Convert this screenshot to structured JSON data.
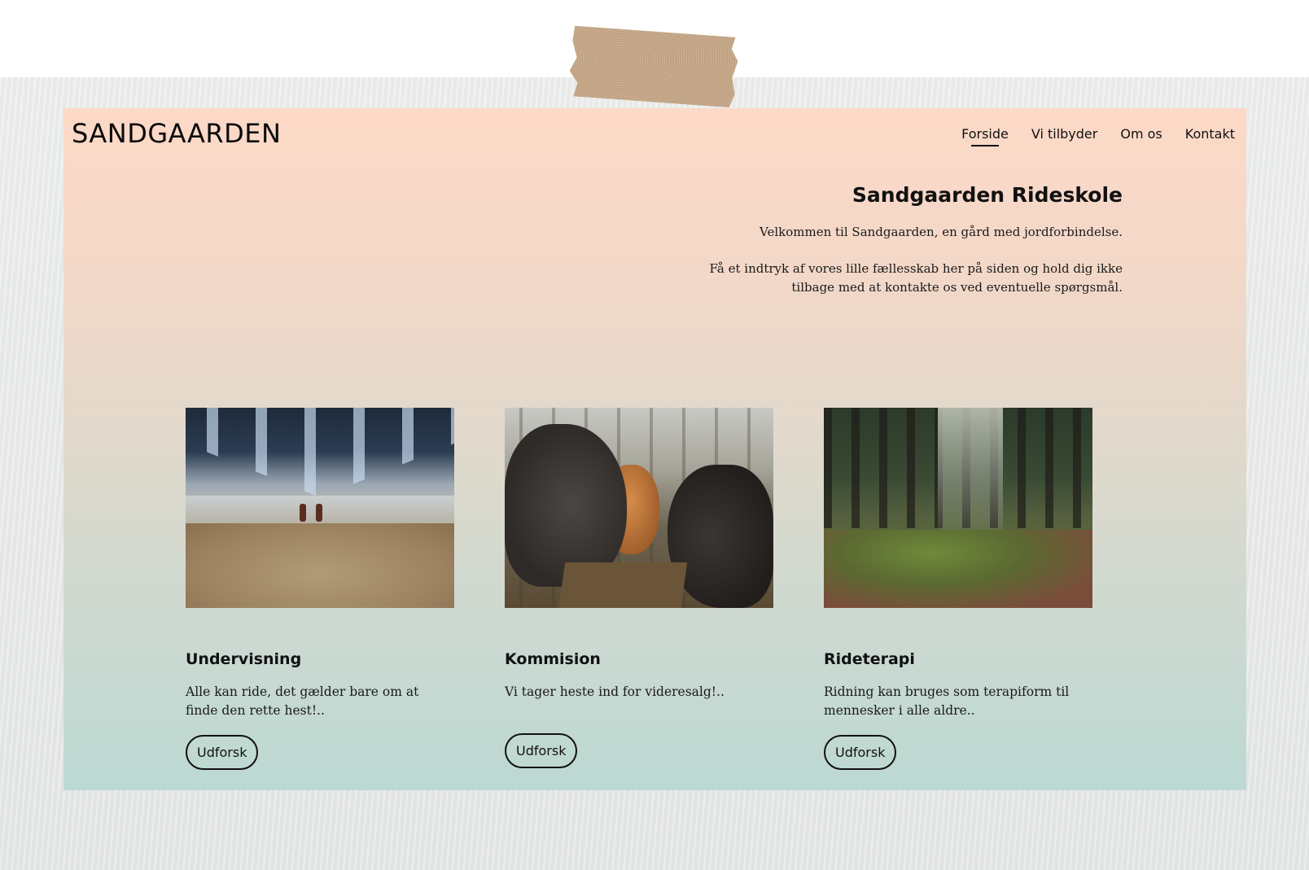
{
  "site": {
    "logo": "SANDGAARDEN",
    "nav": [
      {
        "label": "Forside",
        "active": true
      },
      {
        "label": "Vi tilbyder",
        "active": false
      },
      {
        "label": "Om os",
        "active": false
      },
      {
        "label": "Kontakt",
        "active": false
      }
    ]
  },
  "hero": {
    "title": "Sandgaarden Rideskole",
    "paragraph1": "Velkommen til Sandgaarden, en gård med jordforbindelse.",
    "paragraph2": "Få et indtryk af vores lille fællesskab her på siden og hold dig ikke tilbage med at kontakte os ved eventuelle spørgsmål."
  },
  "cards": [
    {
      "title": "Undervisning",
      "text": "Alle kan ride, det gælder bare om at finde den rette hest!..",
      "button": "Udforsk"
    },
    {
      "title": "Kommision",
      "text": "Vi tager heste ind for videresalg!..",
      "button": "Udforsk"
    },
    {
      "title": "Rideterapi",
      "text": "Ridning kan bruges som terapiform til mennesker i alle aldre..",
      "button": "Udforsk"
    }
  ],
  "colors": {
    "gradient_top": "#fdd9c7",
    "gradient_bottom": "#bcd9d3",
    "tape": "#c8a988"
  }
}
